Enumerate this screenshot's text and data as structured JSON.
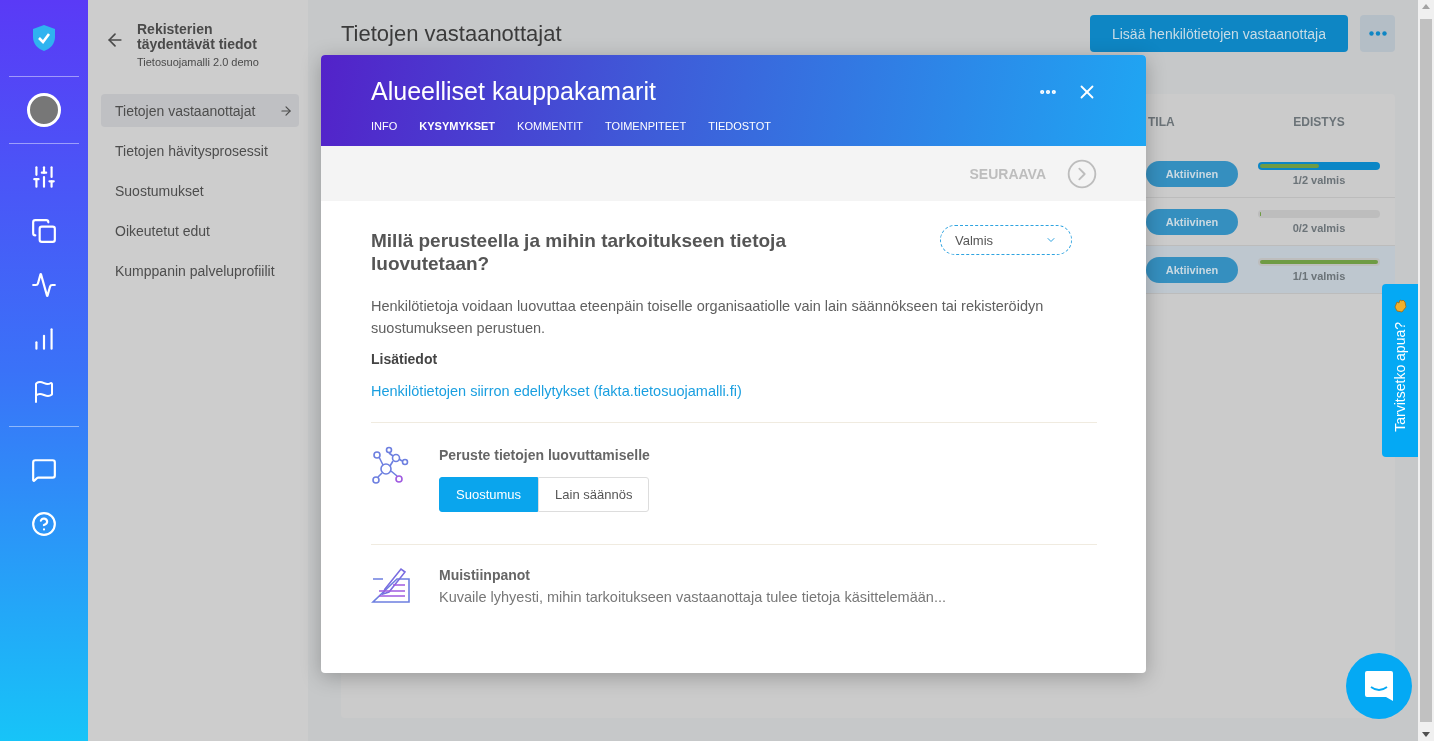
{
  "sidebar": {
    "title": "Rekisterien täydentävät tiedot",
    "subtitle": "Tietosuojamalli 2.0 demo",
    "items": [
      {
        "label": "Tietojen vastaanottajat",
        "selected": true
      },
      {
        "label": "Tietojen hävitysprosessit",
        "selected": false
      },
      {
        "label": "Suostumukset",
        "selected": false
      },
      {
        "label": "Oikeutetut edut",
        "selected": false
      },
      {
        "label": "Kumppanin palveluprofiilit",
        "selected": false
      }
    ]
  },
  "page": {
    "title": "Tietojen vastaanottajat",
    "add_button": "Lisää henkilötietojen vastaanottaja",
    "columns": [
      "TILA",
      "EDISTYS"
    ],
    "rows": [
      {
        "status": "Aktiivinen",
        "level": 0.5,
        "in_progress": true,
        "progress_text": "1/2 valmis",
        "selected": false
      },
      {
        "status": "Aktiivinen",
        "level": 0,
        "in_progress": false,
        "progress_text": "0/2 valmis",
        "selected": false
      },
      {
        "status": "Aktiivinen",
        "level": 1,
        "in_progress": false,
        "progress_text": "1/1 valmis",
        "selected": true
      }
    ]
  },
  "dialog": {
    "title": "Alueelliset kauppakamarit",
    "tabs": [
      {
        "label": "INFO",
        "selected": false
      },
      {
        "label": "KYSYMYKSET",
        "selected": true
      },
      {
        "label": "KOMMENTIT",
        "selected": false
      },
      {
        "label": "TOIMENPITEET",
        "selected": false
      },
      {
        "label": "TIEDOSTOT",
        "selected": false
      }
    ],
    "next_label": "SEURAAVA",
    "question": "Millä perusteella ja mihin tarkoitukseen tietoja luovutetaan?",
    "status_select": {
      "value": "Valmis"
    },
    "description": "Henkilötietoja voidaan luovuttaa eteenpäin toiselle organisaatiolle vain lain säännökseen tai rekisteröidyn suostumukseen perustuen.",
    "more_info_heading": "Lisätiedot",
    "link": "Henkilötietojen siirron edellytykset (fakta.tietosuojamalli.fi)",
    "sections": [
      {
        "kind": "choice",
        "heading": "Peruste tietojen luovuttamiselle",
        "options": [
          {
            "label": "Suostumus",
            "selected": true
          },
          {
            "label": "Lain säännös",
            "selected": false
          }
        ]
      },
      {
        "kind": "notes",
        "heading": "Muistiinpanot",
        "placeholder": "Kuvaile lyhyesti, mihin tarkoitukseen vastaanottaja tulee tietoja käsittelemään..."
      }
    ]
  },
  "help_tab": {
    "label": "Tarvitsetko apua?"
  }
}
